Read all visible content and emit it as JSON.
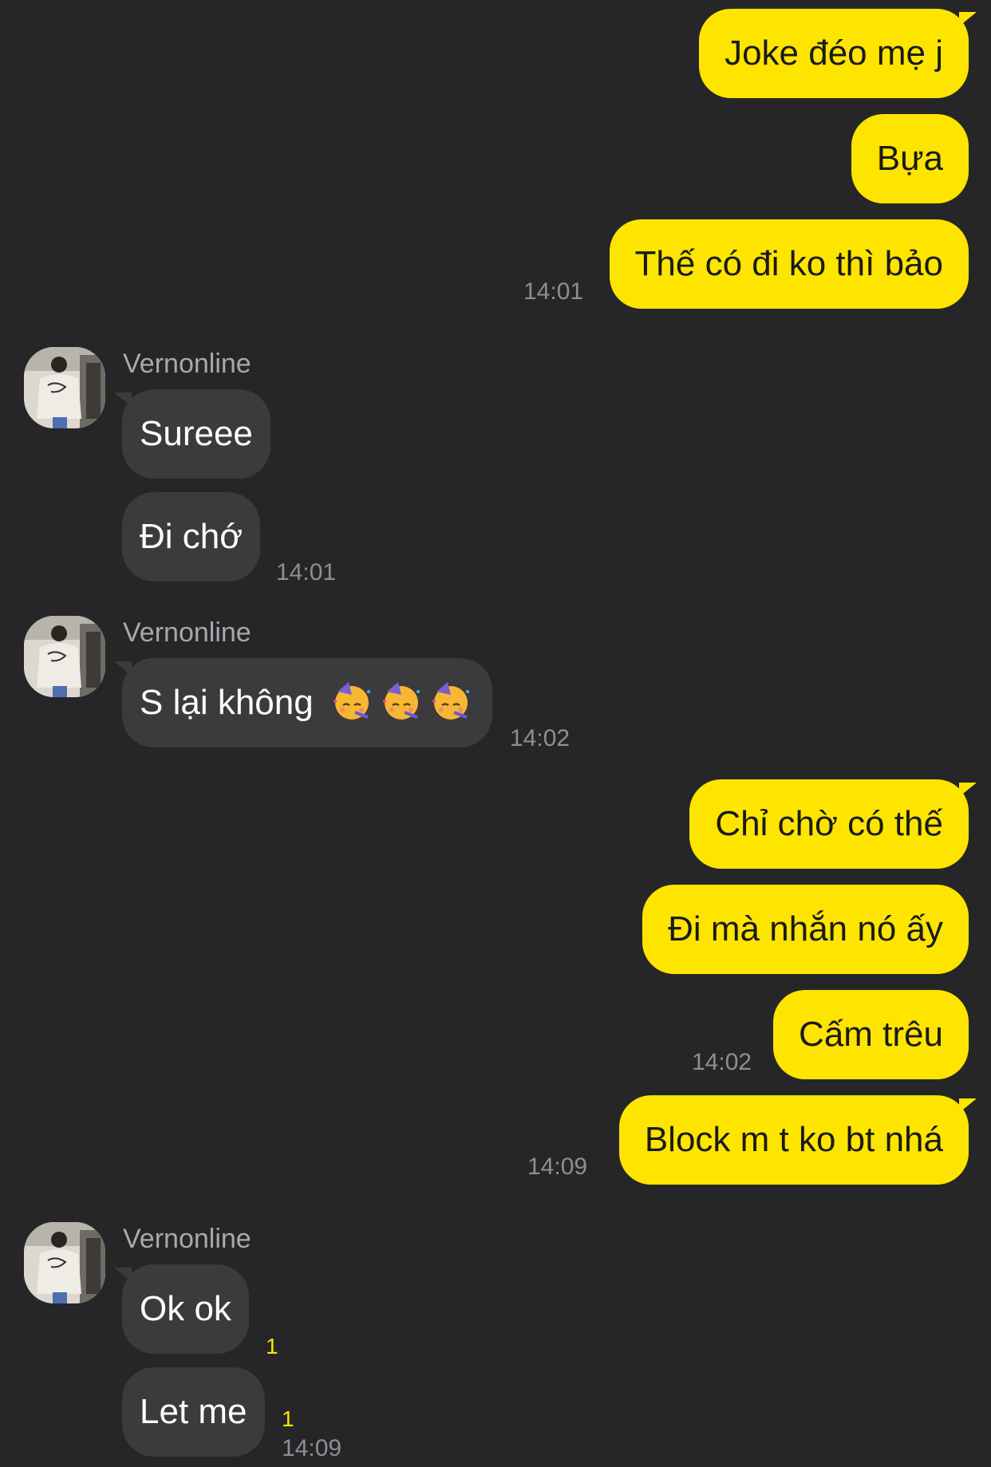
{
  "colors": {
    "background": "#262628",
    "outgoing_bubble": "#fee500",
    "incoming_bubble": "#3b3b3d",
    "timestamp": "#8e8e93",
    "unread_count": "#fee500"
  },
  "sender_name": "Vernonline",
  "messages": [
    {
      "direction": "out",
      "text": "Joke đéo mẹ j"
    },
    {
      "direction": "out",
      "text": "Bựa"
    },
    {
      "direction": "out",
      "text": "Thế có đi ko thì bảo",
      "time": "14:01"
    },
    {
      "direction": "in",
      "sender": "Vernonline",
      "text": "Sureee"
    },
    {
      "direction": "in",
      "text": "Đi chớ",
      "time": "14:01"
    },
    {
      "direction": "in",
      "sender": "Vernonline",
      "text": "S lại không",
      "emoji": "partying-face-emoji ×3",
      "time": "14:02"
    },
    {
      "direction": "out",
      "text": "Chỉ chờ có thế"
    },
    {
      "direction": "out",
      "text": "Đi mà nhắn nó ấy"
    },
    {
      "direction": "out",
      "text": "Cấm trêu",
      "time": "14:02"
    },
    {
      "direction": "out",
      "text": "Block m t ko bt nhá",
      "time": "14:09"
    },
    {
      "direction": "in",
      "sender": "Vernonline",
      "text": "Ok ok",
      "unread": "1"
    },
    {
      "direction": "in",
      "text": "Let me",
      "unread": "1",
      "time": "14:09"
    }
  ]
}
